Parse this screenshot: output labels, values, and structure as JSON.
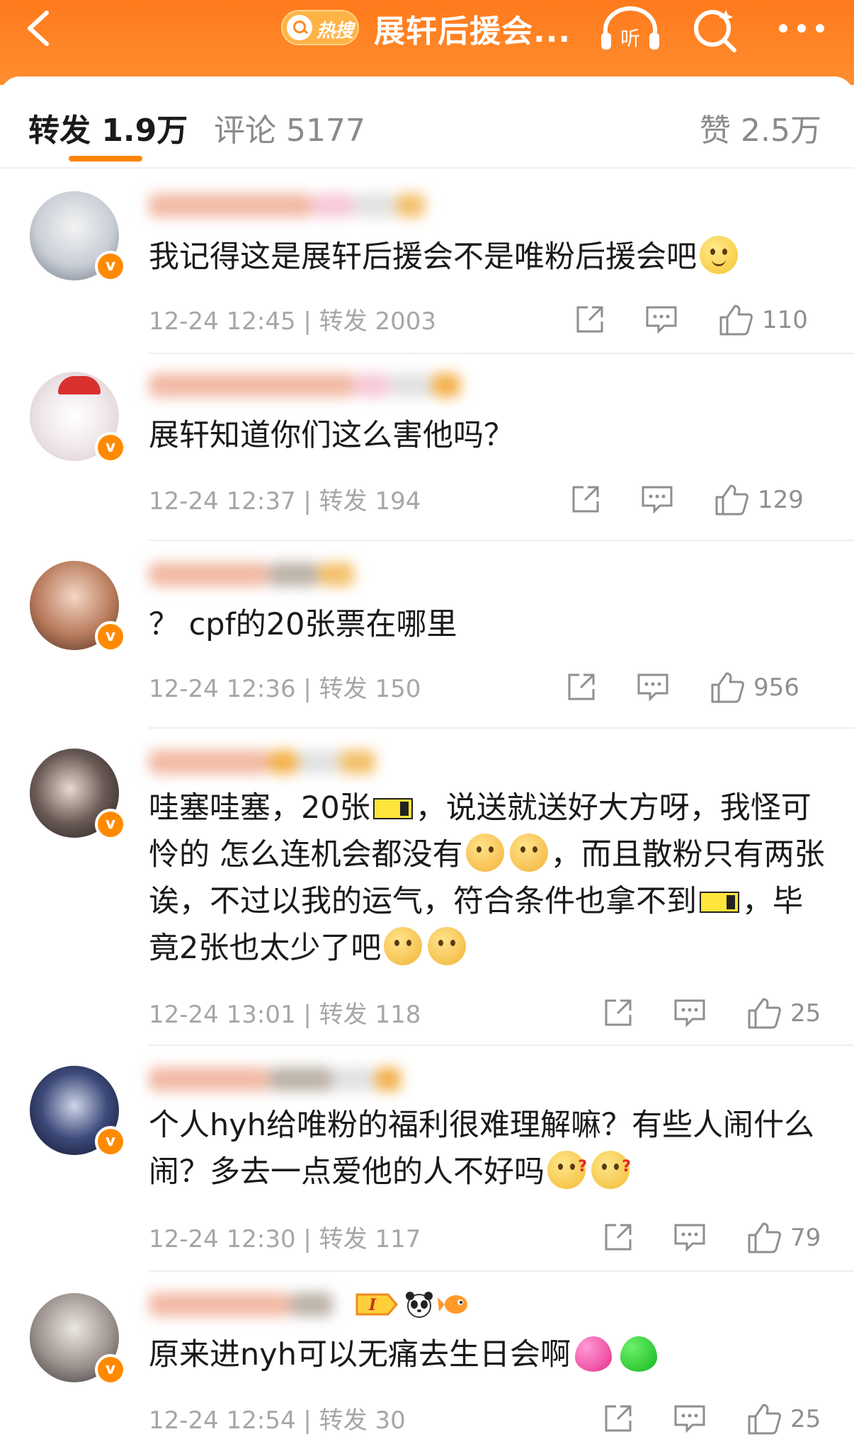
{
  "header": {
    "hot_badge": "热搜",
    "topic_title": "展轩后援会...",
    "icons": [
      "back-icon",
      "listen-icon",
      "search-icon",
      "more-icon"
    ]
  },
  "tabs": {
    "repost": "转发 1.9万",
    "comment": "评论 5177",
    "like": "赞 2.5万"
  },
  "comments": [
    {
      "text_parts": [
        "我记得这是展轩后援会不是唯粉后援会吧"
      ],
      "time": "12-24 12:45",
      "reposts": "转发 2003",
      "likes": "110"
    },
    {
      "text_parts": [
        "展轩知道你们这么害他吗？"
      ],
      "time": "12-24 12:37",
      "reposts": "转发 194",
      "likes": "129"
    },
    {
      "text_parts": [
        "？ cpf的20张票在哪里"
      ],
      "time": "12-24 12:36",
      "reposts": "转发 150",
      "likes": "956"
    },
    {
      "text_parts": [
        "哇塞哇塞，20张",
        "，说送就送好大方呀，我怪可怜的 怎么连机会都没有",
        "，而且散粉只有两张诶，不过以我的运气，符合条件也拿不到",
        "，毕竟2张也太少了吧"
      ],
      "time": "12-24 13:01",
      "reposts": "转发 118",
      "likes": "25"
    },
    {
      "text_parts": [
        "个人hyh给唯粉的福利很难理解嘛？有些人闹什么闹？多去一点爱他的人不好吗"
      ],
      "time": "12-24 12:30",
      "reposts": "转发 117",
      "likes": "79"
    },
    {
      "text_parts": [
        "原来进nyh可以无痛去生日会啊"
      ],
      "time": "12-24 12:54",
      "reposts": "转发 30",
      "likes": "25"
    }
  ]
}
